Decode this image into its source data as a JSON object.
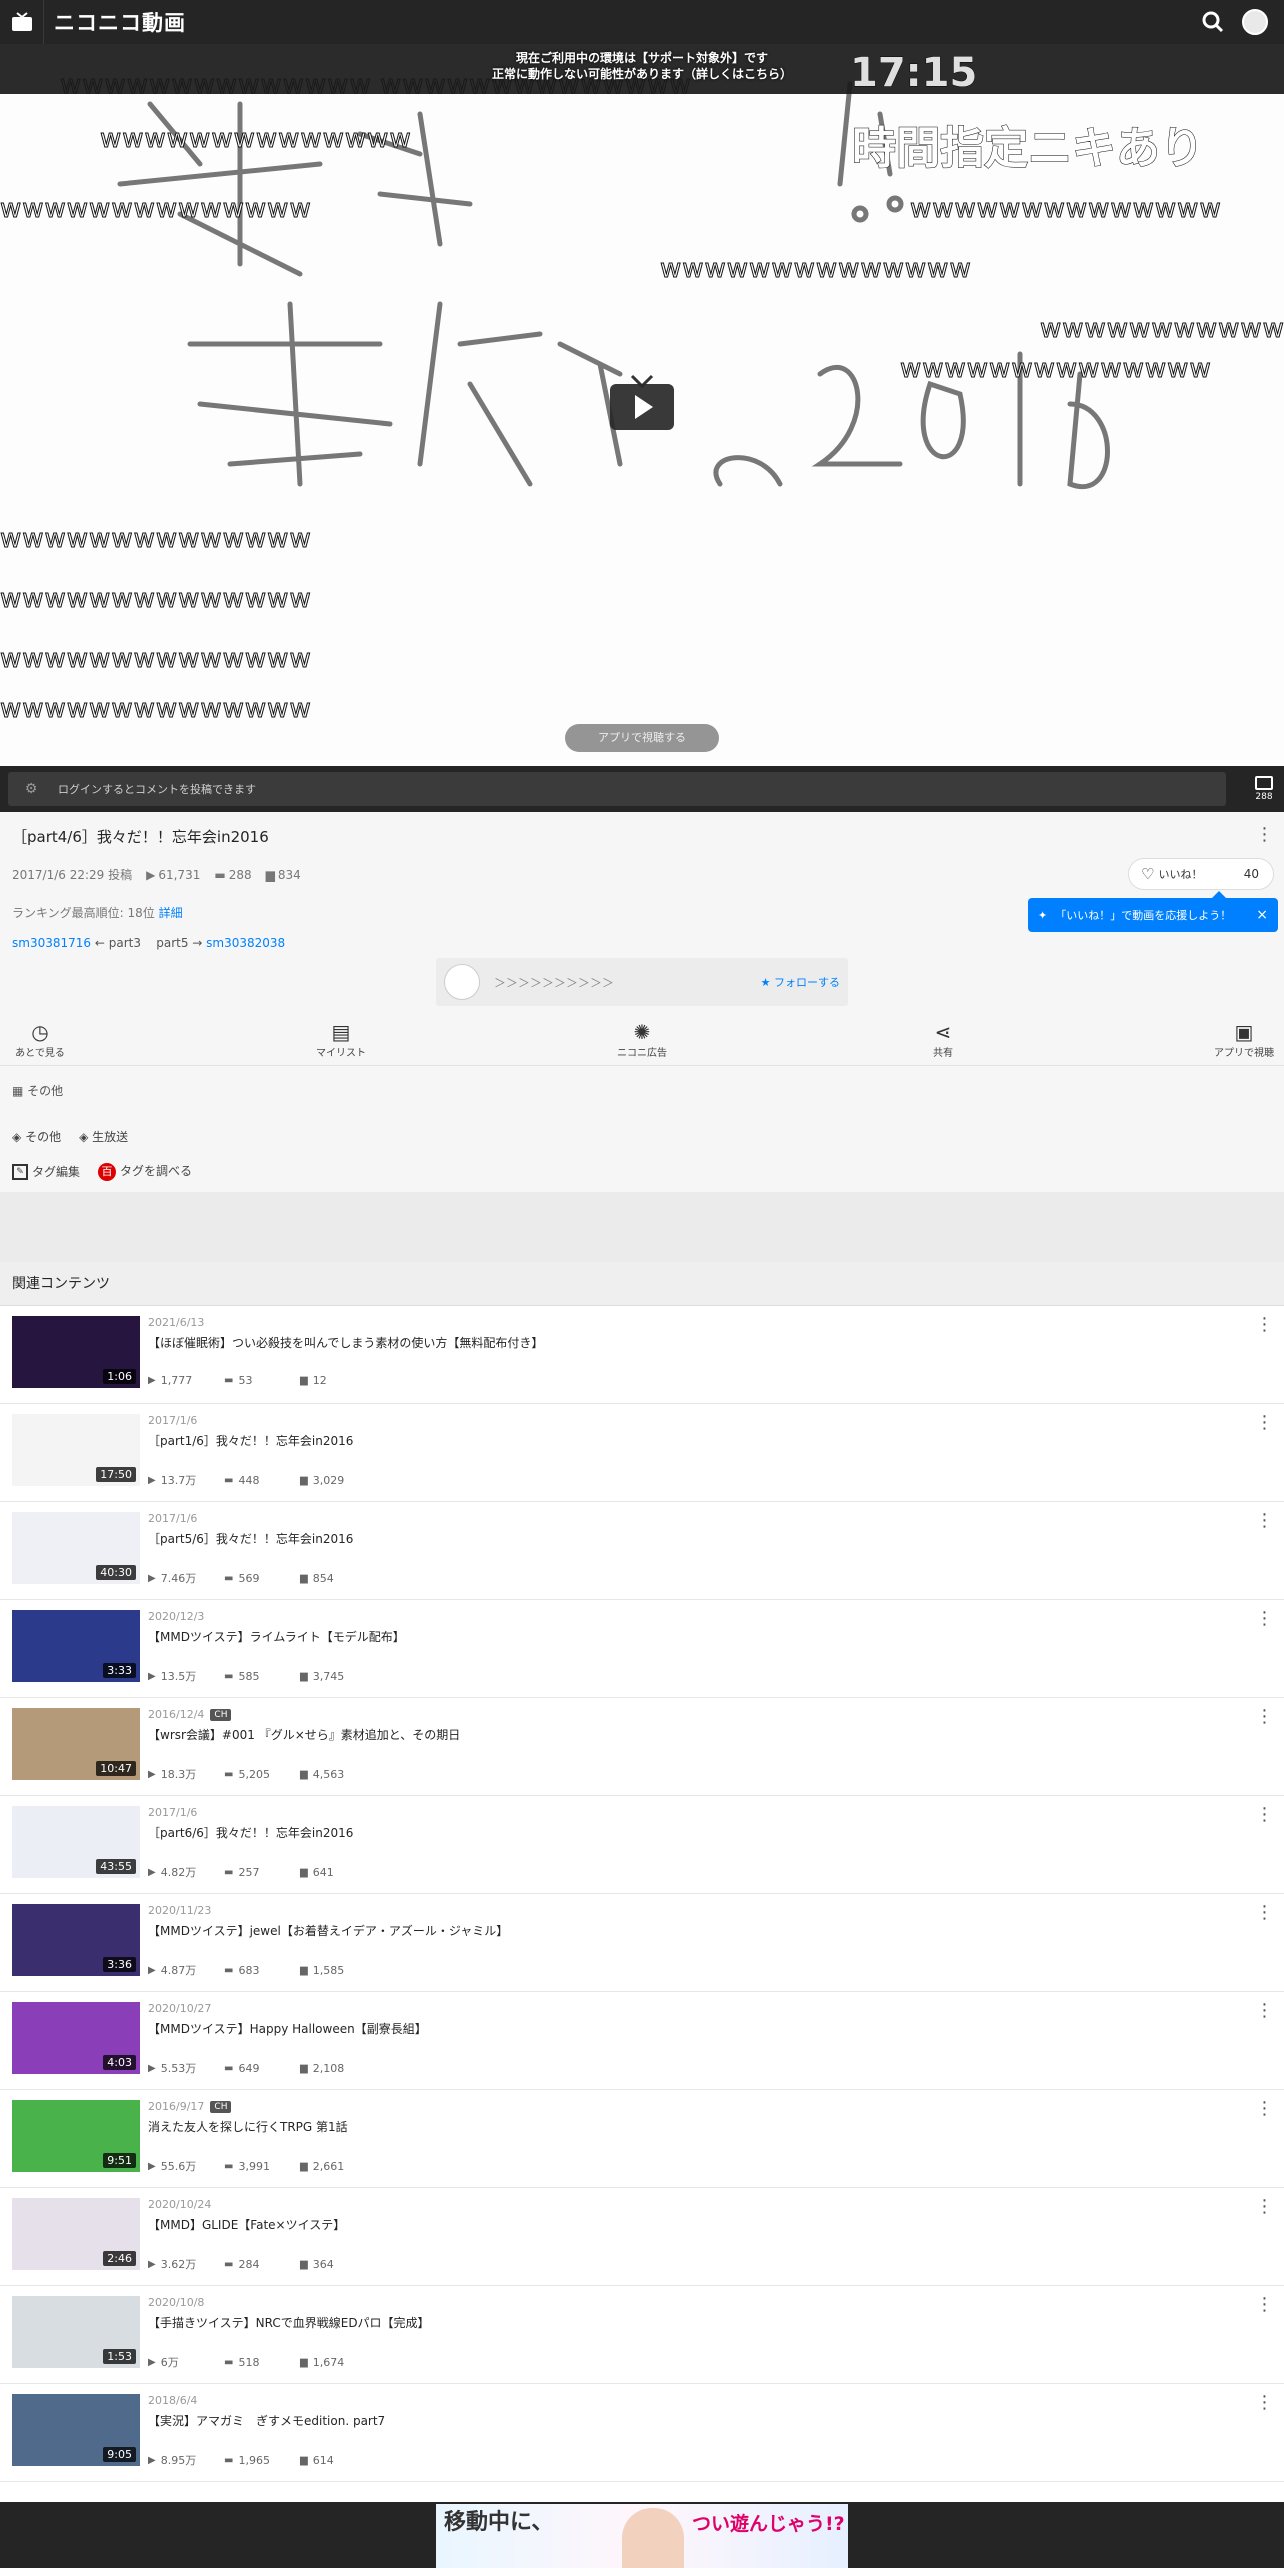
{
  "header": {
    "brand": "ニコニコ動画"
  },
  "player": {
    "notice_line1": "現在ご利用中の環境は【サポート対象外】です",
    "notice_line2": "正常に動作しない可能性があります（詳しくはこちら）",
    "comment_time": "17:15",
    "comment_big": "時間指定ニキあり",
    "wline": "wwwwwwwwwwwwww",
    "app_button": "アプリで視聴する"
  },
  "comment_bar": {
    "placeholder": "ログインするとコメントを投稿できます",
    "count": "288"
  },
  "video": {
    "title": "［part4/6］我々だ！！忘年会in2016",
    "posted": "2017/1/6 22:29 投稿",
    "views": "61,731",
    "comments": "288",
    "mylists": "834",
    "like_label": "いいね！",
    "like_count": "40",
    "like_tooltip": "「いいね！」で動画を応援しよう！",
    "ranking_text": "ランキング最高順位: 18位",
    "ranking_link": "詳細",
    "series_prev_id": "sm30381716",
    "series_prev": "part3",
    "series_next": "part5",
    "series_next_id": "sm30382038",
    "owner_name": "＞＞＞＞＞＞＞＞＞＞",
    "follow": "フォローする",
    "category": "その他"
  },
  "actions": [
    {
      "label": "あとで見る",
      "icon": "clock-icon",
      "glyph": "◷"
    },
    {
      "label": "マイリスト",
      "icon": "mylist-add-icon",
      "glyph": "▤"
    },
    {
      "label": "ニコニ広告",
      "icon": "nicoad-icon",
      "glyph": "✺"
    },
    {
      "label": "共有",
      "icon": "share-icon",
      "glyph": "⋖"
    },
    {
      "label": "アプリで視聴",
      "icon": "tv-icon",
      "glyph": "▣"
    }
  ],
  "tags": [
    "その他",
    "生放送"
  ],
  "tag_tools": {
    "edit": "タグ編集",
    "search": "タグを調べる"
  },
  "related": {
    "heading": "関連コンテンツ",
    "items": [
      {
        "date": "2021/6/13",
        "ch": "",
        "title": "【ほぼ催眠術】つい必殺技を叫んでしまう素材の使い方【無料配布付き】",
        "dur": "1:06",
        "views": "1,777",
        "comments": "53",
        "mylists": "12",
        "thumb": "#26153f"
      },
      {
        "date": "2017/1/6",
        "ch": "",
        "title": "［part1/6］我々だ！！忘年会in2016",
        "dur": "17:50",
        "views": "13.7万",
        "comments": "448",
        "mylists": "3,029",
        "thumb": "#f4f4f4"
      },
      {
        "date": "2017/1/6",
        "ch": "",
        "title": "［part5/6］我々だ！！忘年会in2016",
        "dur": "40:30",
        "views": "7.46万",
        "comments": "569",
        "mylists": "854",
        "thumb": "#eef0f6"
      },
      {
        "date": "2020/12/3",
        "ch": "",
        "title": "【MMDツイステ】ライムライト【モデル配布】",
        "dur": "3:33",
        "views": "13.5万",
        "comments": "585",
        "mylists": "3,745",
        "thumb": "#2b3a8a"
      },
      {
        "date": "2016/12/4",
        "ch": "CH",
        "title": "【wrsr会議】#001 『グル×せら』素材追加と、その期日",
        "dur": "10:47",
        "views": "18.3万",
        "comments": "5,205",
        "mylists": "4,563",
        "thumb": "#b59a7a"
      },
      {
        "date": "2017/1/6",
        "ch": "",
        "title": "［part6/6］我々だ！！忘年会in2016",
        "dur": "43:55",
        "views": "4.82万",
        "comments": "257",
        "mylists": "641",
        "thumb": "#eceef5"
      },
      {
        "date": "2020/11/23",
        "ch": "",
        "title": "【MMDツイステ】jewel【お着替えイデア・アズール・ジャミル】",
        "dur": "3:36",
        "views": "4.87万",
        "comments": "683",
        "mylists": "1,585",
        "thumb": "#3a2e6e"
      },
      {
        "date": "2020/10/27",
        "ch": "",
        "title": "【MMDツイステ】Happy Halloween【副寮長組】",
        "dur": "4:03",
        "views": "5.53万",
        "comments": "649",
        "mylists": "2,108",
        "thumb": "#8a3fb8"
      },
      {
        "date": "2016/9/17",
        "ch": "CH",
        "title": "消えた友人を探しに行くTRPG 第1話",
        "dur": "9:51",
        "views": "55.6万",
        "comments": "3,991",
        "mylists": "2,661",
        "thumb": "#49b24a"
      },
      {
        "date": "2020/10/24",
        "ch": "",
        "title": "【MMD】GLIDE【Fate×ツイステ】",
        "dur": "2:46",
        "views": "3.62万",
        "comments": "284",
        "mylists": "364",
        "thumb": "#e5e0ea"
      },
      {
        "date": "2020/10/8",
        "ch": "",
        "title": "【手描きツイステ】NRCで血界戦線EDパロ【完成】",
        "dur": "1:53",
        "views": "6万",
        "comments": "518",
        "mylists": "1,674",
        "thumb": "#d8dde2"
      },
      {
        "date": "2018/6/4",
        "ch": "",
        "title": "【実況】アマガミ　ぎすメモedition. part7",
        "dur": "9:05",
        "views": "8.95万",
        "comments": "1,965",
        "mylists": "614",
        "thumb": "#4f6a8a"
      }
    ]
  },
  "ad": {
    "line1": "移動中に、",
    "line2": "つい遊んじゃう!?"
  }
}
